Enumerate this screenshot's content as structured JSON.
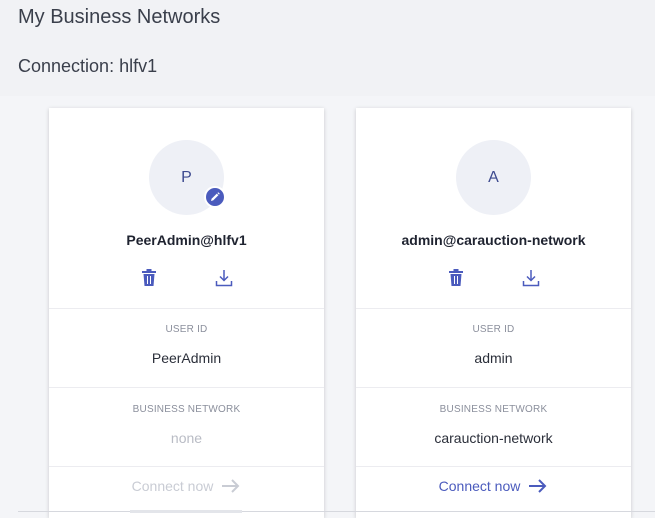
{
  "header": {
    "title": "My Business Networks",
    "connection": "Connection: hlfv1"
  },
  "cards": [
    {
      "avatar_letter": "P",
      "name": "PeerAdmin@hlfv1",
      "user_id_label": "USER ID",
      "user_id": "PeerAdmin",
      "network_label": "BUSINESS NETWORK",
      "network": "none",
      "connect_label": "Connect now",
      "connect_enabled": false,
      "has_badge": true,
      "badge_icon": "pencil-icon"
    },
    {
      "avatar_letter": "A",
      "name": "admin@carauction-network",
      "user_id_label": "USER ID",
      "user_id": "admin",
      "network_label": "BUSINESS NETWORK",
      "network": "carauction-network",
      "connect_label": "Connect now",
      "connect_enabled": true,
      "has_badge": false
    }
  ],
  "colors": {
    "accent": "#4b5bbd",
    "disabled": "#c9ccd4"
  }
}
